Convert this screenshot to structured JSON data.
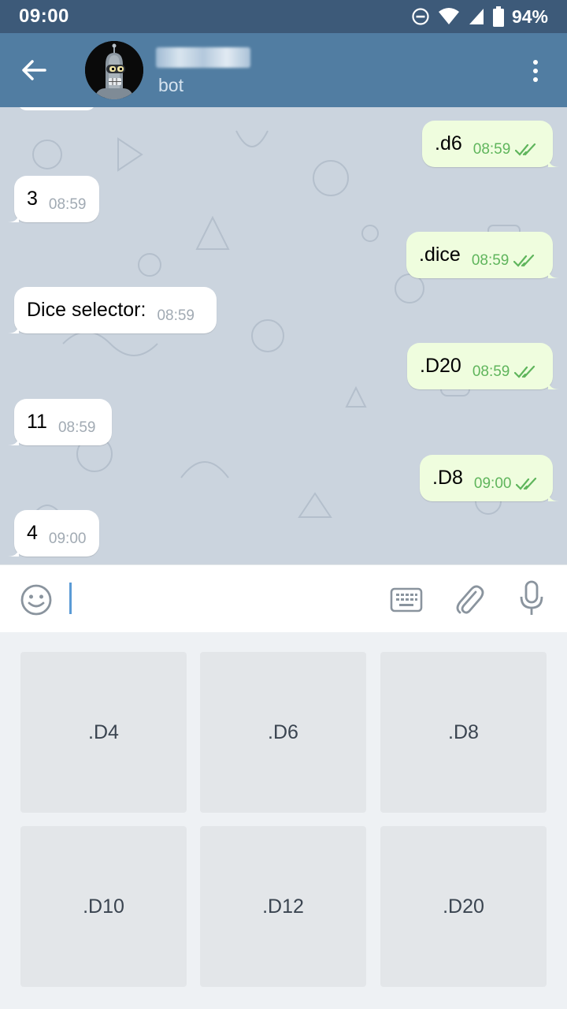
{
  "status_bar": {
    "time": "09:00",
    "battery": "94%",
    "icons": [
      "do-not-disturb-icon",
      "wifi-icon",
      "signal-icon",
      "battery-icon"
    ]
  },
  "header": {
    "subtitle": "bot",
    "back_icon": "arrow-left-icon",
    "menu_icon": "more-vertical-icon",
    "color": "#517da2"
  },
  "messages": [
    {
      "side": "out",
      "text": ".d6",
      "time": "08:59",
      "read": true
    },
    {
      "side": "in",
      "text": "3",
      "time": "08:59"
    },
    {
      "side": "out",
      "text": ".dice",
      "time": "08:59",
      "read": true
    },
    {
      "side": "in",
      "text": "Dice selector:",
      "time": "08:59"
    },
    {
      "side": "out",
      "text": ".D20",
      "time": "08:59",
      "read": true
    },
    {
      "side": "in",
      "text": "11",
      "time": "08:59"
    },
    {
      "side": "out",
      "text": ".D8",
      "time": "09:00",
      "read": true
    },
    {
      "side": "in",
      "text": "4",
      "time": "09:00"
    }
  ],
  "input": {
    "value": "",
    "icons": [
      "emoji-icon",
      "keyboard-icon",
      "paperclip-icon",
      "microphone-icon"
    ]
  },
  "bot_keyboard": {
    "buttons": [
      ".D4",
      ".D6",
      ".D8",
      ".D10",
      ".D12",
      ".D20"
    ]
  },
  "colors": {
    "incoming_bubble": "#ffffff",
    "outgoing_bubble": "#effdde",
    "outgoing_time": "#5fb55c",
    "chat_background": "#cbd4de"
  }
}
